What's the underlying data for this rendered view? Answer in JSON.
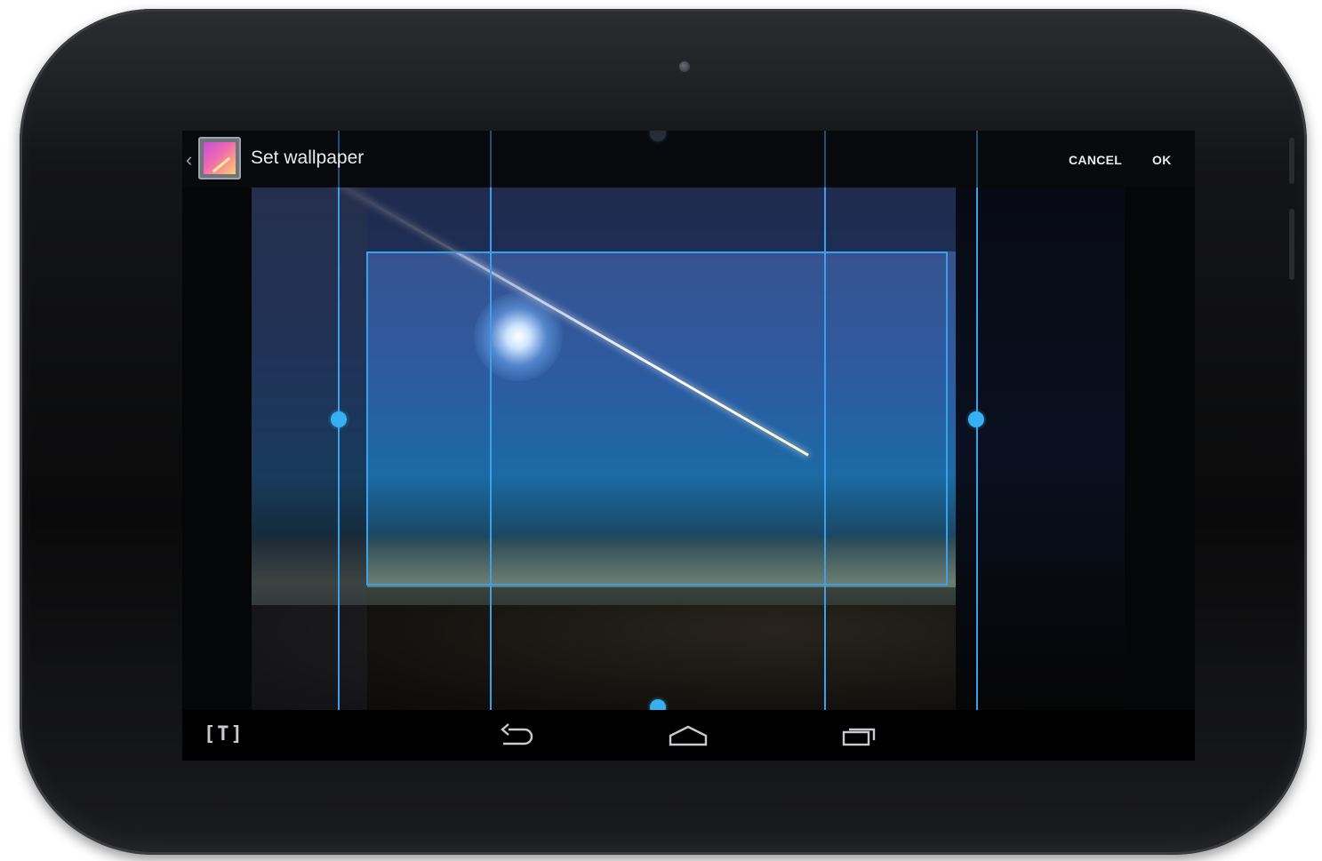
{
  "action_bar": {
    "title": "Set wallpaper",
    "cancel_label": "CANCEL",
    "ok_label": "OK",
    "up_caret": "‹",
    "app_icon": "gallery-app-icon"
  },
  "nav_bar": {
    "logo_text": "[T]",
    "back_icon": "back-icon",
    "home_icon": "home-icon",
    "recents_icon": "recent-apps-icon"
  },
  "colors": {
    "accent": "#36b0f0",
    "text": "#e8eaed"
  }
}
